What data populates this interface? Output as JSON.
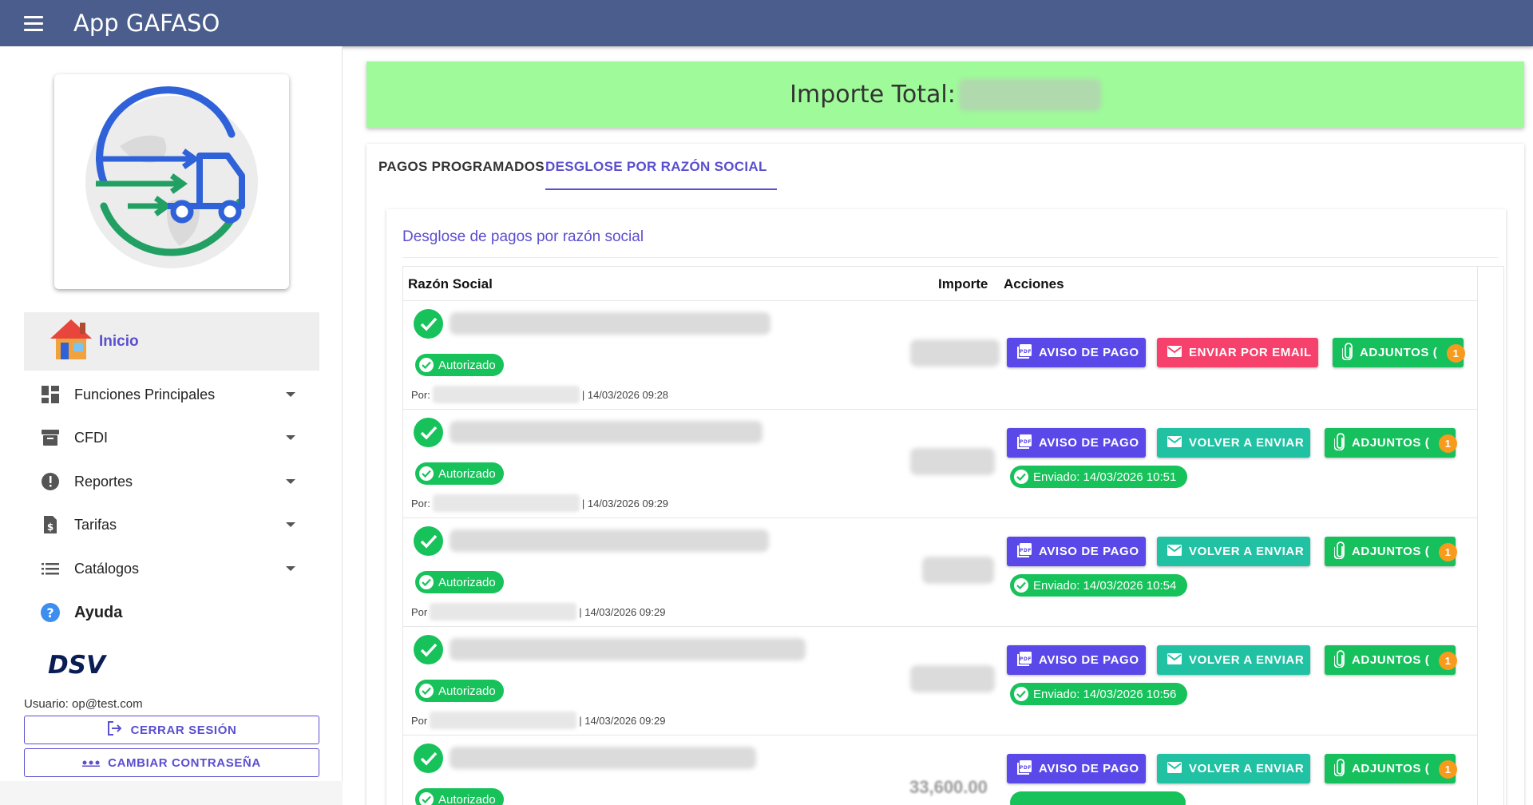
{
  "app": {
    "title": "App GAFASO"
  },
  "sidebar": {
    "home_label": "Inicio",
    "items": [
      {
        "label": "Funciones Principales",
        "icon": "dashboard-icon"
      },
      {
        "label": "CFDI",
        "icon": "archive-icon"
      },
      {
        "label": "Reportes",
        "icon": "alert-icon"
      },
      {
        "label": "Tarifas",
        "icon": "invoice-dollar-icon"
      },
      {
        "label": "Catálogos",
        "icon": "list-icon"
      }
    ],
    "help_label": "Ayuda",
    "brand": "DSV",
    "user_line": "Usuario: op@test.com",
    "logout_label": "CERRAR SESIÓN",
    "change_password_label": "CAMBIAR CONTRASEÑA"
  },
  "banner": {
    "label": "Importe Total:"
  },
  "tabs": [
    {
      "label": "PAGOS PROGRAMADOS",
      "active": false
    },
    {
      "label": "DESGLOSE POR RAZÓN SOCIAL",
      "active": true
    }
  ],
  "section": {
    "title": "Desglose de pagos por razón social"
  },
  "table": {
    "headers": {
      "razon_social": "Razón Social",
      "importe": "Importe",
      "acciones": "Acciones"
    },
    "status_label": "Autorizado",
    "by_prefix": "Por:",
    "by_prefix_short": "Por",
    "button_aviso": "AVISO DE PAGO",
    "button_email": "ENVIAR POR EMAIL",
    "button_resend": "VOLVER A ENVIAR",
    "button_attachments": "ADJUNTOS (",
    "attachments_badge": "1",
    "rows": [
      {
        "timestamp": "| 14/03/2026 09:28",
        "sent": ""
      },
      {
        "timestamp": "| 14/03/2026 09:29",
        "sent": "Enviado: 14/03/2026 10:51"
      },
      {
        "timestamp": "| 14/03/2026 09:29",
        "sent": "Enviado: 14/03/2026 10:54"
      },
      {
        "timestamp": "| 14/03/2026 09:29",
        "sent": "Enviado: 14/03/2026 10:56"
      },
      {
        "importe": "33,600.00"
      }
    ]
  },
  "colors": {
    "appbar": "#4a5d8c",
    "accent": "#5a4fcf",
    "banner": "#9ffa9a",
    "success": "#17c25a",
    "email": "#f5416c",
    "resend": "#21c2a4",
    "badge": "#f89b1d"
  }
}
